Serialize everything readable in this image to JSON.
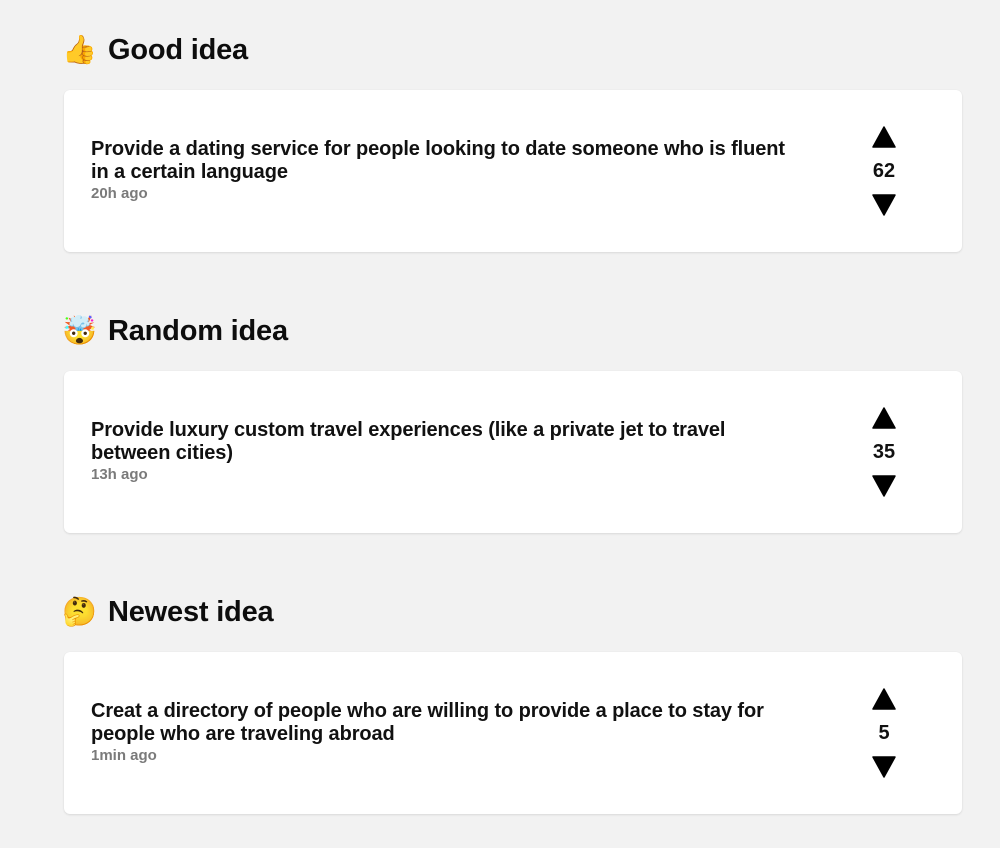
{
  "sections": [
    {
      "emoji": "👍",
      "icon": "thumbs-up-icon",
      "title": "Good idea",
      "idea": {
        "text": "Provide a dating service for people looking to date someone who is fluent in a certain language",
        "time": "20h ago",
        "votes": "62"
      }
    },
    {
      "emoji": "🤯",
      "icon": "exploding-head-icon",
      "title": "Random idea",
      "idea": {
        "text": "Provide luxury custom travel experiences (like a private jet to travel between cities)",
        "time": "13h ago",
        "votes": "35"
      }
    },
    {
      "emoji": "🤔",
      "icon": "thinking-face-icon",
      "title": "Newest idea",
      "idea": {
        "text": "Creat a directory of people who are willing to provide a place to stay for people who are traveling abroad",
        "time": "1min ago",
        "votes": "5"
      }
    }
  ],
  "colors": {
    "background": "#f2f2f2",
    "card": "#ffffff",
    "text": "#111111",
    "muted": "#7a7a7a"
  }
}
